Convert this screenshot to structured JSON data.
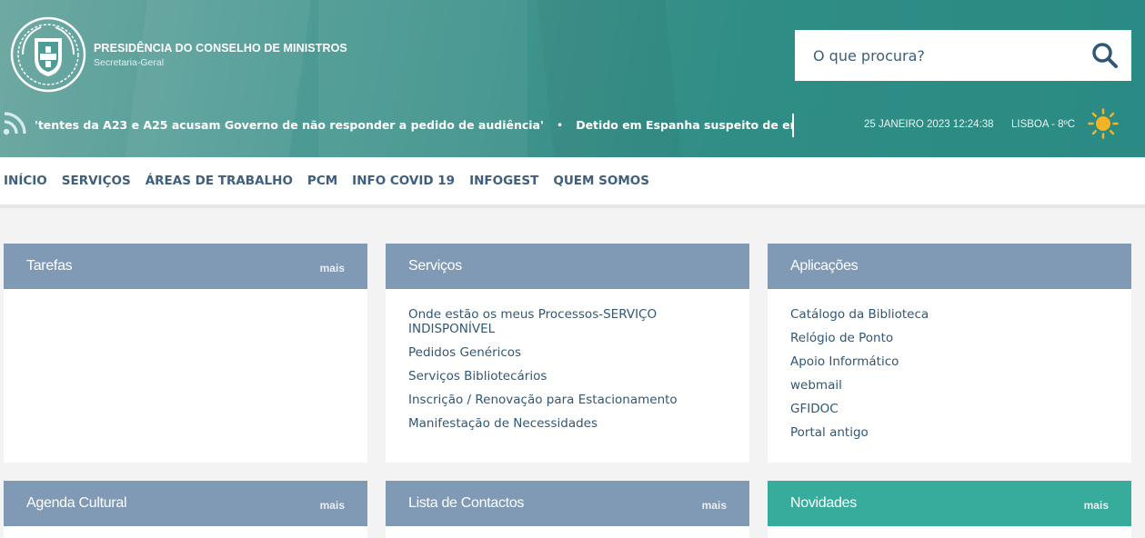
{
  "header": {
    "org_title": "PRESIDÊNCIA DO CONSELHO DE MINISTROS",
    "org_subtitle": "Secretaria-Geral",
    "search_placeholder": "O que procura?",
    "ticker": {
      "item1": "'tentes da A23 e A25 acusam Governo de não responder a pedido de audiência'",
      "separator": "•",
      "item2": "Detido em Espanha suspeito de enviar cartas con"
    },
    "datetime": "25 JANEIRO 2023 12:24:38",
    "weather": "LISBOA - 8ºC",
    "colors": {
      "teal": "#2a8b84",
      "sun": "#f5b324"
    }
  },
  "nav": {
    "items": [
      "INÍCIO",
      "SERVIÇOS",
      "ÁREAS DE TRABALHO",
      "PCM",
      "INFO COVID 19",
      "INFOGEST",
      "QUEM SOMOS"
    ],
    "color": "#3e5f7d"
  },
  "panels": {
    "more_label": "mais",
    "tarefas": {
      "title": "Tarefas"
    },
    "servicos": {
      "title": "Serviços",
      "links": [
        "Onde estão os meus Processos-SERVIÇO INDISPONÍVEL",
        "Pedidos Genéricos",
        "Serviços Bibliotecários",
        "Inscrição / Renovação para Estacionamento",
        "Manifestação de Necessidades"
      ]
    },
    "aplicacoes": {
      "title": "Aplicações",
      "links": [
        "Catálogo da Biblioteca",
        "Relógio de Ponto",
        "Apoio Informático",
        "webmail",
        "GFIDOC",
        "Portal antigo"
      ]
    },
    "agenda": {
      "title": "Agenda Cultural"
    },
    "contactos": {
      "title": "Lista de Contactos"
    },
    "novidades": {
      "title": "Novidades"
    },
    "colors": {
      "head": "#8099b5",
      "head_green": "#37ab9c"
    }
  }
}
